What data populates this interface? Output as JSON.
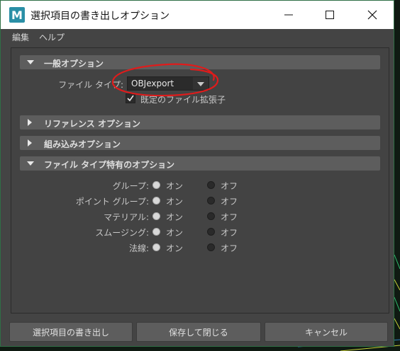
{
  "window": {
    "title": "選択項目の書き出しオプション",
    "app_icon_letter": "M"
  },
  "menubar": {
    "items": [
      "編集",
      "ヘルプ"
    ]
  },
  "sections": {
    "general": {
      "label": "一般オプション",
      "expanded": true,
      "file_type_label": "ファイル タイプ:",
      "file_type_value": "OBJexport",
      "default_ext_label": "既定のファイル拡張子",
      "default_ext_checked": true
    },
    "reference": {
      "label": "リファレンス オプション",
      "expanded": false
    },
    "embed": {
      "label": "組み込みオプション",
      "expanded": false
    },
    "filetype_specific": {
      "label": "ファイル タイプ特有のオプション",
      "expanded": true,
      "on_label": "オン",
      "off_label": "オフ",
      "rows": [
        {
          "label": "グループ:",
          "selected": "on"
        },
        {
          "label": "ポイント グループ:",
          "selected": "on"
        },
        {
          "label": "マテリアル:",
          "selected": "on"
        },
        {
          "label": "スムージング:",
          "selected": "on"
        },
        {
          "label": "法線:",
          "selected": "on"
        }
      ]
    }
  },
  "buttons": {
    "export": "選択項目の書き出し",
    "save_close": "保存して閉じる",
    "cancel": "キャンセル"
  },
  "colors": {
    "annotation": "#e01b1b",
    "app_icon_bg": "#2a8fa6"
  }
}
